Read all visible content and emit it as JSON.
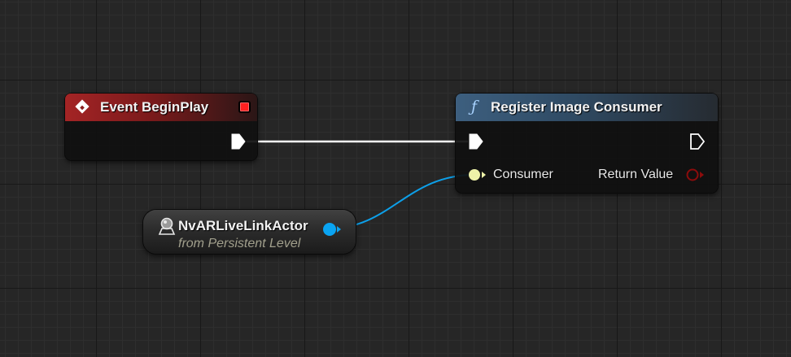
{
  "graph": {
    "event_node": {
      "title": "Event BeginPlay",
      "icon": "event-diamond-icon",
      "header_color": "#a42425"
    },
    "function_node": {
      "title": "Register Image Consumer",
      "icon": "function-f-icon",
      "header_color": "#3d5f7f",
      "inputs": [
        {
          "label": "Consumer",
          "pin_color": "#eef2a8"
        }
      ],
      "outputs": [
        {
          "label": "Return Value",
          "pin_color": "#8c0c0c"
        }
      ]
    },
    "variable_node": {
      "title": "NvARLiveLinkActor",
      "subtitle": "from Persistent Level",
      "icon": "actor-reference-icon",
      "pin_color": "#0aa4f2"
    },
    "wires": {
      "exec_color": "#ffffff",
      "object_color": "#0d9fe8"
    }
  }
}
